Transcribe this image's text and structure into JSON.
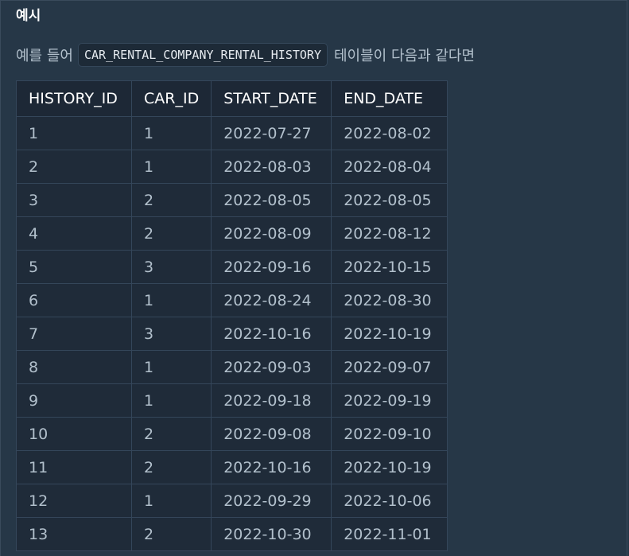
{
  "section": {
    "title": "예시"
  },
  "intro": {
    "prefix": "예를 들어",
    "table_name": "CAR_RENTAL_COMPANY_RENTAL_HISTORY",
    "suffix": "테이블이 다음과 같다면"
  },
  "table": {
    "columns": [
      "HISTORY_ID",
      "CAR_ID",
      "START_DATE",
      "END_DATE"
    ],
    "rows": [
      [
        "1",
        "1",
        "2022-07-27",
        "2022-08-02"
      ],
      [
        "2",
        "1",
        "2022-08-03",
        "2022-08-04"
      ],
      [
        "3",
        "2",
        "2022-08-05",
        "2022-08-05"
      ],
      [
        "4",
        "2",
        "2022-08-09",
        "2022-08-12"
      ],
      [
        "5",
        "3",
        "2022-09-16",
        "2022-10-15"
      ],
      [
        "6",
        "1",
        "2022-08-24",
        "2022-08-30"
      ],
      [
        "7",
        "3",
        "2022-10-16",
        "2022-10-19"
      ],
      [
        "8",
        "1",
        "2022-09-03",
        "2022-09-07"
      ],
      [
        "9",
        "1",
        "2022-09-18",
        "2022-09-19"
      ],
      [
        "10",
        "2",
        "2022-09-08",
        "2022-09-10"
      ],
      [
        "11",
        "2",
        "2022-10-16",
        "2022-10-19"
      ],
      [
        "12",
        "1",
        "2022-09-29",
        "2022-10-06"
      ],
      [
        "13",
        "2",
        "2022-10-30",
        "2022-11-01"
      ]
    ]
  }
}
